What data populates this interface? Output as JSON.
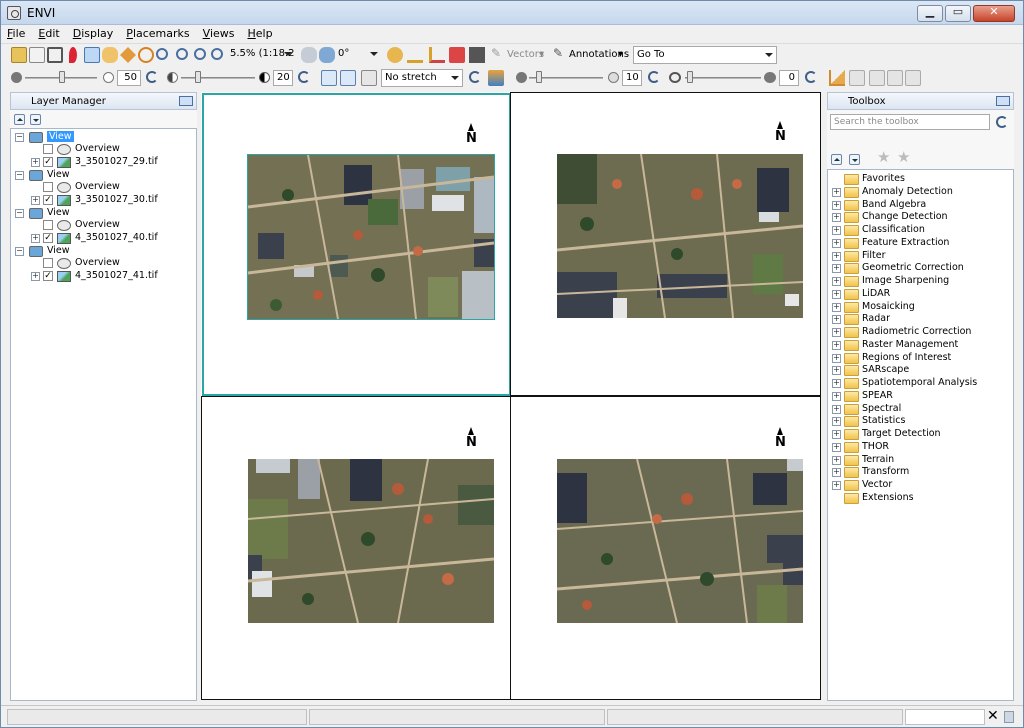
{
  "window": {
    "title": "ENVI"
  },
  "menu": [
    "File",
    "Edit",
    "Display",
    "Placemarks",
    "Views",
    "Help"
  ],
  "toolbar": {
    "zoom_value": "5.5% (1:18.2)",
    "rotation_value": "0°",
    "vectors_label": "Vectors",
    "annotations_label": "Annotations",
    "goto_value": "Go To",
    "brightness": "50",
    "contrast": "20",
    "stretch_value": "No stretch",
    "sharpen": "10",
    "transparency": "0"
  },
  "layer_manager": {
    "title": "Layer Manager",
    "views": [
      {
        "label": "View",
        "selected": true,
        "overview": "Overview",
        "layer": "3_3501027_29.tif"
      },
      {
        "label": "View",
        "selected": false,
        "overview": "Overview",
        "layer": "3_3501027_30.tif"
      },
      {
        "label": "View",
        "selected": false,
        "overview": "Overview",
        "layer": "4_3501027_40.tif"
      },
      {
        "label": "View",
        "selected": false,
        "overview": "Overview",
        "layer": "4_3501027_41.tif"
      }
    ]
  },
  "toolbox": {
    "title": "Toolbox",
    "search_placeholder": "Search the toolbox",
    "items": [
      "Favorites",
      "Anomaly Detection",
      "Band Algebra",
      "Change Detection",
      "Classification",
      "Feature Extraction",
      "Filter",
      "Geometric Correction",
      "Image Sharpening",
      "LiDAR",
      "Mosaicking",
      "Radar",
      "Radiometric Correction",
      "Raster Management",
      "Regions of Interest",
      "SARscape",
      "Spatiotemporal Analysis",
      "SPEAR",
      "Spectral",
      "Statistics",
      "Target Detection",
      "THOR",
      "Terrain",
      "Transform",
      "Vector",
      "Extensions"
    ]
  },
  "views_grid": {
    "north_label": "N"
  },
  "colors": {
    "active_view": "#2aa6a6",
    "selection": "#3399ff"
  }
}
